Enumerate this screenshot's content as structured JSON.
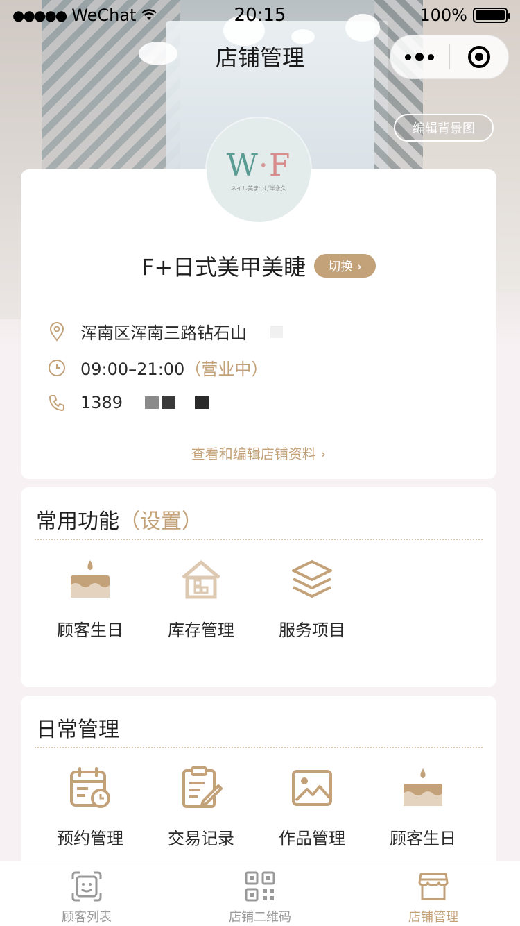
{
  "status_bar": {
    "carrier": "WeChat",
    "time": "20:15",
    "battery": "100%"
  },
  "nav": {
    "title": "店铺管理"
  },
  "hero": {
    "edit_background_label": "编辑背景图"
  },
  "store": {
    "logo_text": "W·F",
    "logo_subtext": "ネイル美まつげ半永久",
    "name": "F+日式美甲美睫",
    "switch_label": "切换 ›",
    "address": "浑南区浑南三路钻石山",
    "hours": "09:00–21:00",
    "hours_status": "（营业中）",
    "phone": "1389",
    "edit_link": "查看和编辑店铺资料 ›"
  },
  "common": {
    "title": "常用功能",
    "settings_label": "（设置）",
    "items": [
      {
        "label": "顾客生日",
        "icon": "cake-icon"
      },
      {
        "label": "库存管理",
        "icon": "warehouse-icon"
      },
      {
        "label": "服务项目",
        "icon": "layers-icon"
      }
    ]
  },
  "daily": {
    "title": "日常管理",
    "items": [
      {
        "label": "预约管理",
        "icon": "calendar-clock-icon"
      },
      {
        "label": "交易记录",
        "icon": "clipboard-edit-icon"
      },
      {
        "label": "作品管理",
        "icon": "image-icon"
      },
      {
        "label": "顾客生日",
        "icon": "cake-icon"
      }
    ]
  },
  "tabbar": {
    "tabs": [
      {
        "label": "顾客列表",
        "icon": "face-scan-icon"
      },
      {
        "label": "店铺二维码",
        "icon": "qrcode-icon"
      },
      {
        "label": "店铺管理",
        "icon": "store-icon"
      }
    ],
    "active_index": 2
  },
  "colors": {
    "accent": "#c3a27a",
    "background": "#f7f1f3",
    "tab_inactive": "#999999"
  }
}
